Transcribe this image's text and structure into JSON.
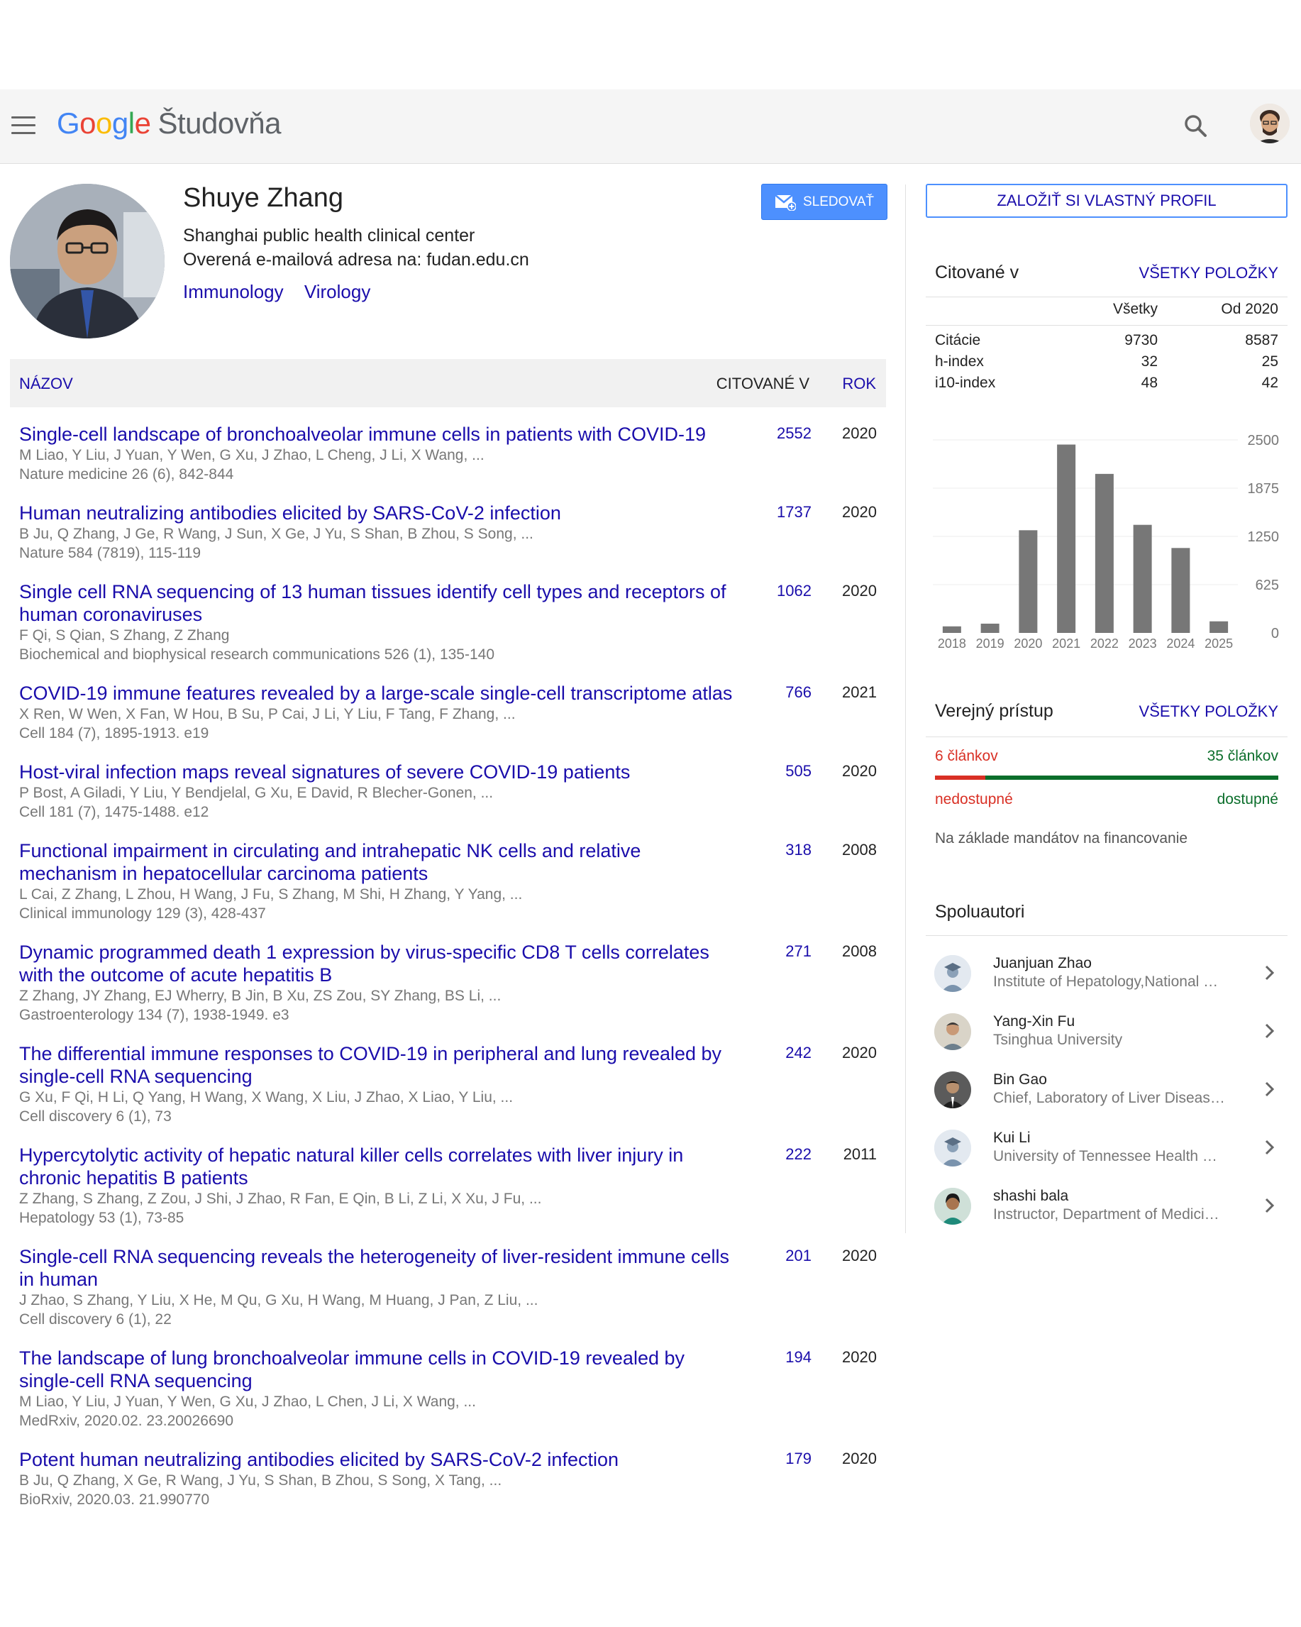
{
  "header": {
    "logo": {
      "g1": "G",
      "g2": "o",
      "g3": "o",
      "g4": "g",
      "g5": "l",
      "g6": "e"
    },
    "product": "Študovňa"
  },
  "profile": {
    "name": "Shuye Zhang",
    "affiliation": "Shanghai public health clinical center",
    "email": "Overená e-mailová adresa na: fudan.edu.cn",
    "interests": [
      "Immunology",
      "Virology"
    ],
    "follow_label": "SLEDOVAŤ"
  },
  "table": {
    "col_title": "NÁZOV",
    "col_cited": "CITOVANÉ V",
    "col_year": "ROK"
  },
  "articles": [
    {
      "title": "Single-cell landscape of bronchoalveolar immune cells in patients with COVID-19",
      "authors": "M Liao, Y Liu, J Yuan, Y Wen, G Xu, J Zhao, L Cheng, J Li, X Wang, ...",
      "venue": "Nature medicine 26 (6), 842-844",
      "cites": "2552",
      "year": "2020"
    },
    {
      "title": "Human neutralizing antibodies elicited by SARS-CoV-2 infection",
      "authors": "B Ju, Q Zhang, J Ge, R Wang, J Sun, X Ge, J Yu, S Shan, B Zhou, S Song, ...",
      "venue": "Nature 584 (7819), 115-119",
      "cites": "1737",
      "year": "2020"
    },
    {
      "title": "Single cell RNA sequencing of 13 human tissues identify cell types and receptors of human coronaviruses",
      "authors": "F Qi, S Qian, S Zhang, Z Zhang",
      "venue": "Biochemical and biophysical research communications 526 (1), 135-140",
      "cites": "1062",
      "year": "2020"
    },
    {
      "title": "COVID-19 immune features revealed by a large-scale single-cell transcriptome atlas",
      "authors": "X Ren, W Wen, X Fan, W Hou, B Su, P Cai, J Li, Y Liu, F Tang, F Zhang, ...",
      "venue": "Cell 184 (7), 1895-1913. e19",
      "cites": "766",
      "year": "2021"
    },
    {
      "title": "Host-viral infection maps reveal signatures of severe COVID-19 patients",
      "authors": "P Bost, A Giladi, Y Liu, Y Bendjelal, G Xu, E David, R Blecher-Gonen, ...",
      "venue": "Cell 181 (7), 1475-1488. e12",
      "cites": "505",
      "year": "2020"
    },
    {
      "title": "Functional impairment in circulating and intrahepatic NK cells and relative mechanism in hepatocellular carcinoma patients",
      "authors": "L Cai, Z Zhang, L Zhou, H Wang, J Fu, S Zhang, M Shi, H Zhang, Y Yang, ...",
      "venue": "Clinical immunology 129 (3), 428-437",
      "cites": "318",
      "year": "2008"
    },
    {
      "title": "Dynamic programmed death 1 expression by virus-specific CD8 T cells correlates with the outcome of acute hepatitis B",
      "authors": "Z Zhang, JY Zhang, EJ Wherry, B Jin, B Xu, ZS Zou, SY Zhang, BS Li, ...",
      "venue": "Gastroenterology 134 (7), 1938-1949. e3",
      "cites": "271",
      "year": "2008"
    },
    {
      "title": "The differential immune responses to COVID-19 in peripheral and lung revealed by single-cell RNA sequencing",
      "authors": "G Xu, F Qi, H Li, Q Yang, H Wang, X Wang, X Liu, J Zhao, X Liao, Y Liu, ...",
      "venue": "Cell discovery 6 (1), 73",
      "cites": "242",
      "year": "2020"
    },
    {
      "title": "Hypercytolytic activity of hepatic natural killer cells correlates with liver injury in chronic hepatitis B patients",
      "authors": "Z Zhang, S Zhang, Z Zou, J Shi, J Zhao, R Fan, E Qin, B Li, Z Li, X Xu, J Fu, ...",
      "venue": "Hepatology 53 (1), 73-85",
      "cites": "222",
      "year": "2011"
    },
    {
      "title": "Single-cell RNA sequencing reveals the heterogeneity of liver-resident immune cells in human",
      "authors": "J Zhao, S Zhang, Y Liu, X He, M Qu, G Xu, H Wang, M Huang, J Pan, Z Liu, ...",
      "venue": "Cell discovery 6 (1), 22",
      "cites": "201",
      "year": "2020"
    },
    {
      "title": "The landscape of lung bronchoalveolar immune cells in COVID-19 revealed by single-cell RNA sequencing",
      "authors": "M Liao, Y Liu, J Yuan, Y Wen, G Xu, J Zhao, L Chen, J Li, X Wang, ...",
      "venue": "MedRxiv, 2020.02. 23.20026690",
      "cites": "194",
      "year": "2020"
    },
    {
      "title": "Potent human neutralizing antibodies elicited by SARS-CoV-2 infection",
      "authors": "B Ju, Q Zhang, X Ge, R Wang, J Yu, S Shan, B Zhou, S Song, X Tang, ...",
      "venue": "BioRxiv, 2020.03. 21.990770",
      "cites": "179",
      "year": "2020"
    }
  ],
  "sidebar": {
    "create_profile": "ZALOŽIŤ SI VLASTNÝ PROFIL",
    "cited_by": {
      "title": "Citované v",
      "all_link": "VŠETKY POLOŽKY",
      "col_all": "Všetky",
      "col_since": "Od 2020",
      "rows": [
        {
          "label": "Citácie",
          "all": "9730",
          "since": "8587"
        },
        {
          "label": "h-index",
          "all": "32",
          "since": "25"
        },
        {
          "label": "i10-index",
          "all": "48",
          "since": "42"
        }
      ]
    },
    "public_access": {
      "title": "Verejný prístup",
      "all_link": "VŠETKY POLOŽKY",
      "unavailable_count": "6 článkov",
      "available_count": "35 článkov",
      "unavailable_label": "nedostupné",
      "available_label": "dostupné",
      "unavailable_fraction": 0.146,
      "note": "Na základe mandátov na financovanie",
      "colors": {
        "unavailable": "#d93025",
        "available": "#0b6e2b"
      }
    },
    "coauthors": {
      "title": "Spoluautori",
      "items": [
        {
          "name": "Juanjuan Zhao",
          "affiliation": "Institute of Hepatology,National …",
          "avatar": "default-scholar-icon"
        },
        {
          "name": "Yang-Xin Fu",
          "affiliation": "Tsinghua University",
          "avatar": "photo"
        },
        {
          "name": "Bin Gao",
          "affiliation": "Chief, Laboratory of Liver Diseas…",
          "avatar": "photo"
        },
        {
          "name": "Kui Li",
          "affiliation": "University of Tennessee Health …",
          "avatar": "default-scholar-icon"
        },
        {
          "name": "shashi bala",
          "affiliation": "Instructor, Department of Medici…",
          "avatar": "photo"
        }
      ]
    }
  },
  "chart_data": {
    "type": "bar",
    "categories": [
      "2018",
      "2019",
      "2020",
      "2021",
      "2022",
      "2023",
      "2024",
      "2025"
    ],
    "values": [
      85,
      120,
      1330,
      2440,
      2060,
      1400,
      1100,
      150
    ],
    "yticks": [
      0,
      625,
      1250,
      1875,
      2500
    ],
    "ylim": [
      0,
      2500
    ],
    "title": "",
    "xlabel": "",
    "ylabel": "",
    "grid": true,
    "bar_color": "#777777"
  }
}
